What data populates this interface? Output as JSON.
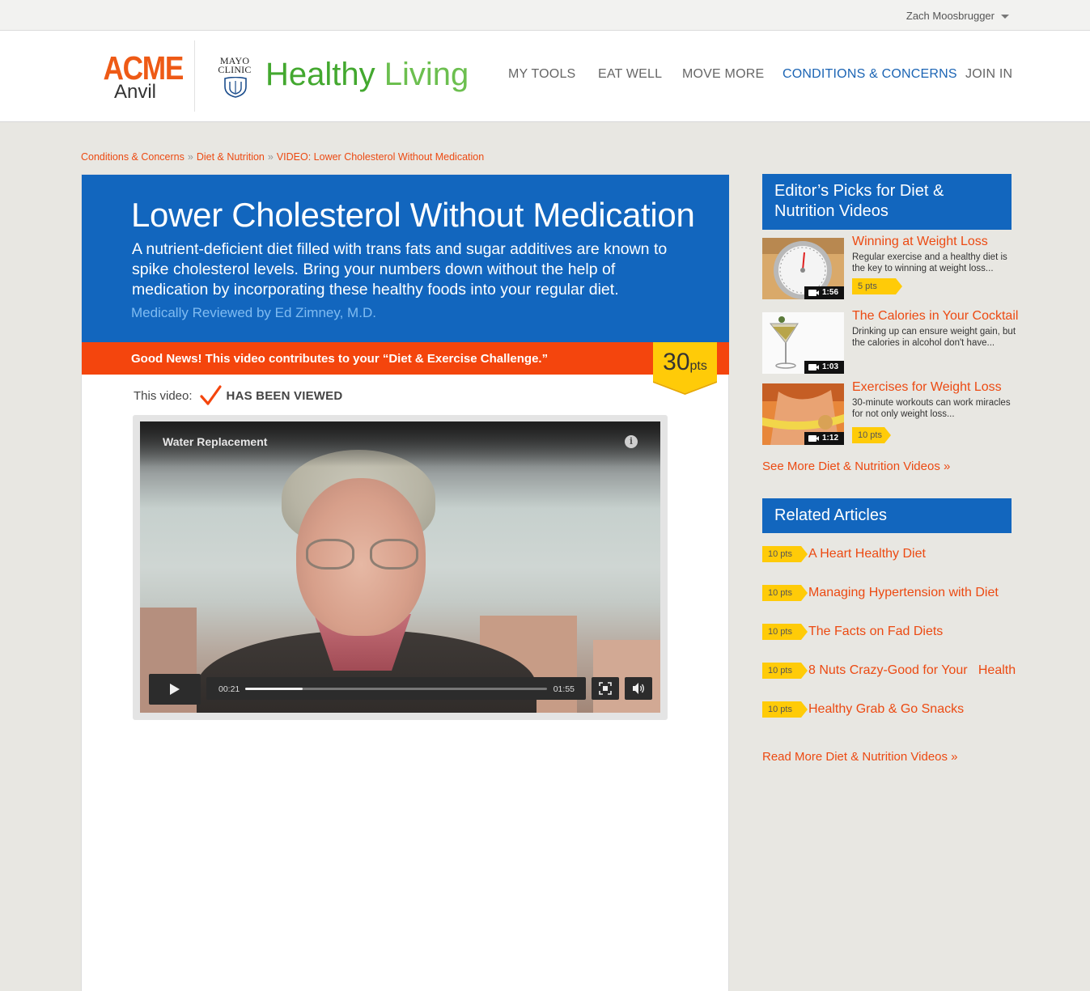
{
  "topbar": {
    "user_name": "Zach Moosbrugger"
  },
  "header": {
    "acme_top": "ACME",
    "acme_bottom": "Anvil",
    "mayo_line1": "MAYO",
    "mayo_line2": "CLINIC",
    "title_a": "Healthy",
    "title_b": "Living",
    "nav": [
      {
        "label": "MY TOOLS",
        "active": false
      },
      {
        "label": "EAT WELL",
        "active": false
      },
      {
        "label": "MOVE MORE",
        "active": false
      },
      {
        "label": "CONDITIONS & CONCERNS",
        "active": true
      },
      {
        "label": "JOIN IN",
        "active": false
      }
    ]
  },
  "breadcrumb": {
    "items": [
      "Conditions & Concerns",
      "Diet & Nutrition",
      "VIDEO: Lower Cholesterol Without Medication"
    ],
    "separator": "»"
  },
  "hero": {
    "title": "Lower Cholesterol Without Medication",
    "description": "A nutrient-deficient diet filled with trans fats and sugar additives are known to spike cholesterol levels. Bring your numbers down without the help of medication by incorporating these healthy foods into your regular diet.",
    "reviewed": "Medically Reviewed by Ed Zimney, M.D."
  },
  "news": {
    "text": "Good News!  This video contributes to your “Diet & Exercise Challenge.”",
    "points_value": "30",
    "points_unit": "pts"
  },
  "viewed": {
    "label": "This video:",
    "status": "HAS BEEN VIEWED"
  },
  "video": {
    "title": "Water Replacement",
    "info": "i",
    "current_time": "00:21",
    "total_time": "01:55",
    "progress": 0.19
  },
  "sidebar": {
    "picks_heading": "Editor’s Picks for Diet & Nutrition Videos",
    "picks": [
      {
        "title": "Winning at Weight Loss",
        "desc": "Regular exercise and a healthy diet is the key to winning at weight loss...",
        "duration": "1:56",
        "points": "5 pts"
      },
      {
        "title": "The Calories in Your Cocktail",
        "desc": "Drinking up can ensure weight gain, but the calories in alcohol don't have...",
        "duration": "1:03",
        "points": ""
      },
      {
        "title": "Exercises for Weight Loss",
        "desc": "30-minute workouts can work miracles for not only weight loss...",
        "duration": "1:12",
        "points": "10 pts"
      }
    ],
    "see_more": "See More Diet & Nutrition Videos »",
    "articles_heading": "Related Articles",
    "articles": [
      {
        "points": "10 pts",
        "title": "A Heart Healthy Diet"
      },
      {
        "points": "10 pts",
        "title": "Managing Hypertension with Diet"
      },
      {
        "points": "10 pts",
        "title": "The Facts on Fad Diets"
      },
      {
        "points": "10 pts",
        "title": "8 Nuts Crazy-Good for Your   Health"
      },
      {
        "points": "10 pts",
        "title": "Healthy Grab & Go Snacks"
      }
    ],
    "read_more": "Read More Diet & Nutrition Videos »"
  },
  "colors": {
    "brand_blue": "#1266be",
    "accent_orange": "#ec4a12",
    "points_yellow": "#ffcb08",
    "green": "#43a82f"
  }
}
